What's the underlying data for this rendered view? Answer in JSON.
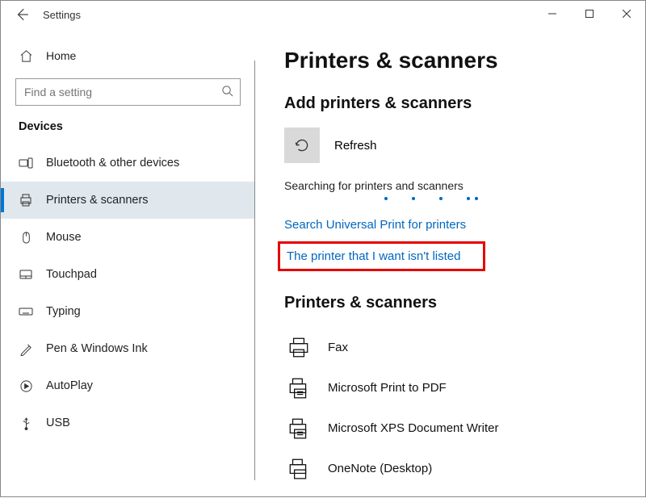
{
  "app_title": "Settings",
  "win_controls": {
    "min": "minimize",
    "max": "maximize",
    "close": "close"
  },
  "sidebar": {
    "home": "Home",
    "search_placeholder": "Find a setting",
    "category": "Devices",
    "items": [
      {
        "label": "Bluetooth & other devices"
      },
      {
        "label": "Printers & scanners"
      },
      {
        "label": "Mouse"
      },
      {
        "label": "Touchpad"
      },
      {
        "label": "Typing"
      },
      {
        "label": "Pen & Windows Ink"
      },
      {
        "label": "AutoPlay"
      },
      {
        "label": "USB"
      }
    ]
  },
  "main": {
    "title": "Printers & scanners",
    "add_heading": "Add printers & scanners",
    "refresh_label": "Refresh",
    "searching_status": "Searching for printers and scanners",
    "link_universal": "Search Universal Print for printers",
    "link_not_listed": "The printer that I want isn't listed",
    "list_heading": "Printers & scanners",
    "printers": [
      "Fax",
      "Microsoft Print to PDF",
      "Microsoft XPS Document Writer",
      "OneNote (Desktop)"
    ]
  }
}
